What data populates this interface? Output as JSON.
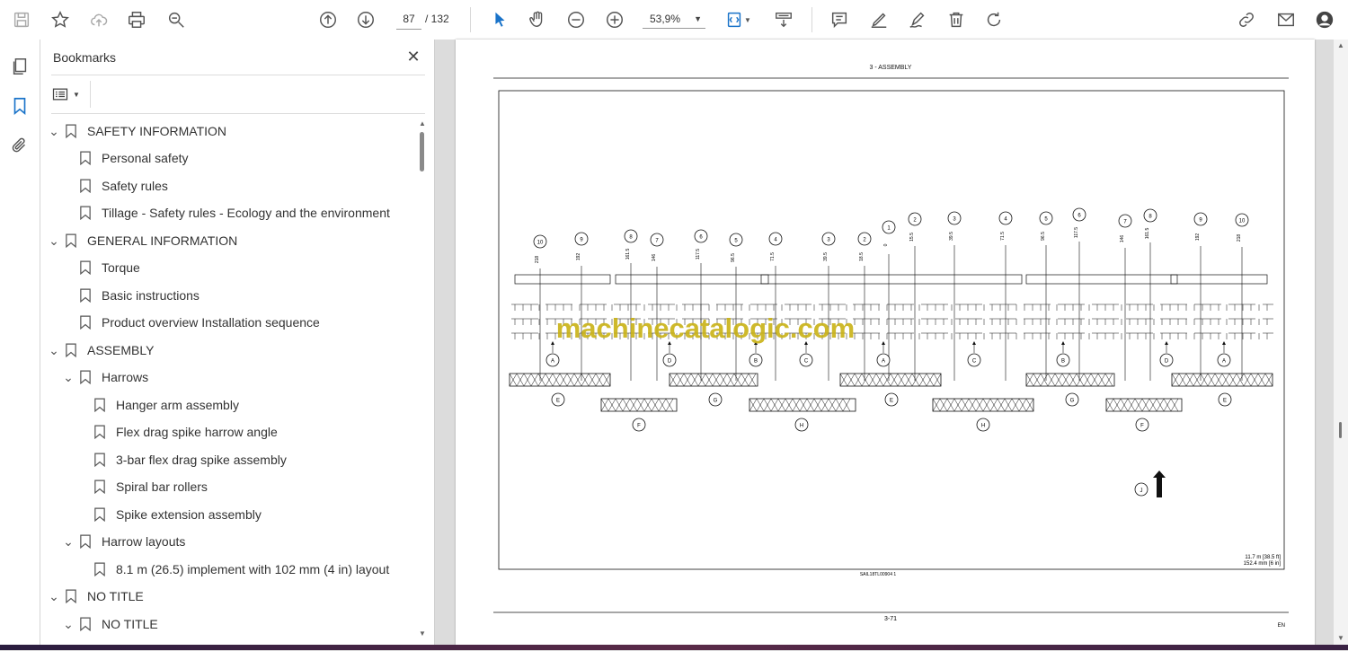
{
  "toolbar": {
    "page_current": "87",
    "page_total": "/ 132",
    "zoom": "53,9%"
  },
  "bookmarks_panel": {
    "title": "Bookmarks",
    "items": [
      {
        "label": "SAFETY INFORMATION",
        "level": 0,
        "expanded": true
      },
      {
        "label": "Personal safety",
        "level": 1
      },
      {
        "label": "Safety rules",
        "level": 1
      },
      {
        "label": "Tillage - Safety rules - Ecology and the environment",
        "level": 1
      },
      {
        "label": "GENERAL INFORMATION",
        "level": 0,
        "expanded": true
      },
      {
        "label": "Torque",
        "level": 1
      },
      {
        "label": "Basic instructions",
        "level": 1
      },
      {
        "label": "Product overview Installation sequence",
        "level": 1
      },
      {
        "label": "ASSEMBLY",
        "level": 0,
        "expanded": true
      },
      {
        "label": "Harrows",
        "level": 1,
        "expanded": true
      },
      {
        "label": "Hanger arm assembly",
        "level": 2
      },
      {
        "label": "Flex drag spike harrow angle",
        "level": 2
      },
      {
        "label": "3-bar flex drag spike assembly",
        "level": 2
      },
      {
        "label": "Spiral bar rollers",
        "level": 2
      },
      {
        "label": "Spike extension assembly",
        "level": 2
      },
      {
        "label": "Harrow layouts",
        "level": 1,
        "expanded": true
      },
      {
        "label": "8.1 m (26.5) implement with 102 mm (4 in) layout",
        "level": 2
      },
      {
        "label": "NO TITLE",
        "level": 0,
        "expanded": true
      },
      {
        "label": "NO TITLE",
        "level": 1,
        "expanded": true
      }
    ]
  },
  "document": {
    "header": "3 - ASSEMBLY",
    "watermark": "machinecatalogic.com",
    "dims_line1": "11.7 m [38.5 ft]",
    "dims_line2": "152.4 mm [6 in]",
    "fig_id": "SAIL18TL00904   1",
    "page_number": "3-71",
    "lang": "EN",
    "top_callouts": [
      "10",
      "9",
      "8",
      "7",
      "6",
      "5",
      "4",
      "3",
      "2",
      "1",
      "2",
      "3",
      "4",
      "5",
      "6",
      "7",
      "8",
      "9",
      "10"
    ],
    "top_values": [
      "218",
      "192",
      "161.5",
      "146",
      "117.5",
      "96.5",
      "71.5",
      "39.5",
      "18.5",
      "0",
      "15.5",
      "39.5",
      "71.5",
      "96.5",
      "117.5",
      "146",
      "161.5",
      "192",
      "218"
    ],
    "upper_letters": [
      "A",
      "D",
      "B",
      "C",
      "A",
      "C",
      "B",
      "D",
      "A"
    ],
    "lower_letters_row1": [
      "E",
      "G",
      "E",
      "G",
      "E"
    ],
    "lower_letters_row2": [
      "F",
      "H",
      "H",
      "F"
    ],
    "direction_label": "J"
  }
}
